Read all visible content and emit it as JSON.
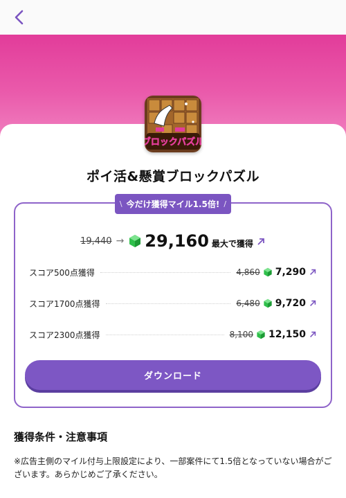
{
  "colors": {
    "accent": "#7b55c1",
    "hero": "#e23c9a",
    "gem": "#2fbf4b"
  },
  "nav": {
    "back_icon": "chevron-left-icon"
  },
  "app": {
    "title": "ポイ活&懸賞ブロックパズル",
    "icon_text": "ブロックパズル"
  },
  "promo": {
    "left": "\\",
    "text": "今だけ獲得マイル1.5倍!",
    "right": "/"
  },
  "main_reward": {
    "old": "19,440",
    "value": "29,160",
    "suffix": "最大で獲得"
  },
  "rows": [
    {
      "label": "スコア500点獲得",
      "old": "4,860",
      "value": "7,290"
    },
    {
      "label": "スコア1700点獲得",
      "old": "6,480",
      "value": "9,720"
    },
    {
      "label": "スコア2300点獲得",
      "old": "8,100",
      "value": "12,150"
    }
  ],
  "download": {
    "label": "ダウンロード"
  },
  "conditions": {
    "title": "獲得条件・注意事項",
    "note": "※広告主側のマイル付与上限設定により、一部案件にて1.5倍となっていない場合がございます。あらかじめご了承ください。"
  }
}
